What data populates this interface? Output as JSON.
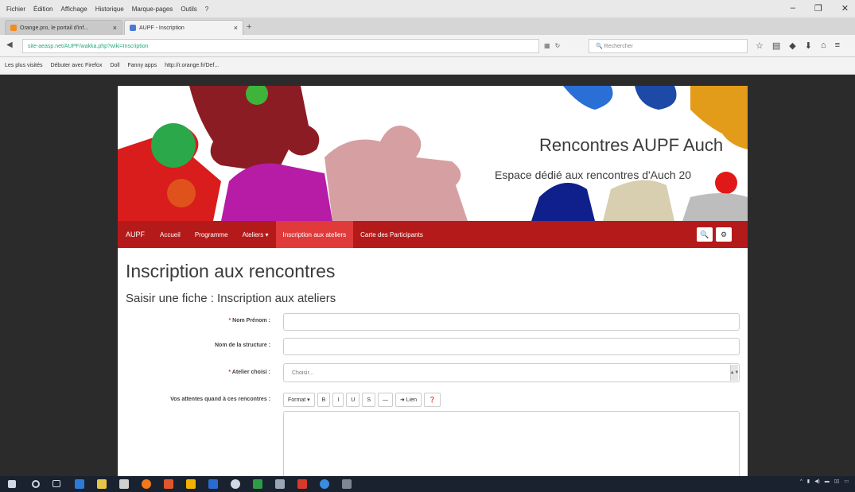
{
  "browser": {
    "menu": [
      "Fichier",
      "Édition",
      "Affichage",
      "Historique",
      "Marque-pages",
      "Outils",
      "?"
    ],
    "tabs": [
      {
        "label": "Orange.pro, le portail d'inf...",
        "favicon_color": "#f28c1b"
      },
      {
        "label": "AUPF - Inscription",
        "favicon_color": "#4a7bd0"
      }
    ],
    "url": "site-aeasp.net/AUPF/wakka.php?wiki=Inscription",
    "search_placeholder": "Rechercher",
    "bookmarks": [
      "Les plus visités",
      "Débuter avec Firefox",
      "Doll",
      "Fanny apps",
      "http://r.orange.fr/Def..."
    ]
  },
  "site": {
    "title": "Rencontres AUPF Auch",
    "subtitle": "Espace dédié aux rencontres d'Auch 20",
    "nav": {
      "brand": "AUPF",
      "items": [
        "Accueil",
        "Programme",
        "Ateliers ▾",
        "Inscription aux ateliers",
        "Carte des Participants"
      ],
      "active_index": 3
    }
  },
  "form": {
    "page_title": "Inscription aux rencontres",
    "subtitle": "Saisir une fiche : Inscription aux ateliers",
    "fields": [
      {
        "label": "Nom Prénom :",
        "required": true
      },
      {
        "label": "Nom de la structure :",
        "required": false
      },
      {
        "label": "Atelier choisi :",
        "required": true,
        "value": "Choisir..."
      },
      {
        "label": "Vos attentes quand à ces rencontres :",
        "required": false
      }
    ],
    "editor_toolbar": [
      "Format ▾",
      "B",
      "I",
      "U",
      "S",
      "—",
      "➜ Lien",
      "❓"
    ]
  },
  "colors": {
    "nav_red": "#b51a1a",
    "nav_active": "#e03a3a"
  }
}
